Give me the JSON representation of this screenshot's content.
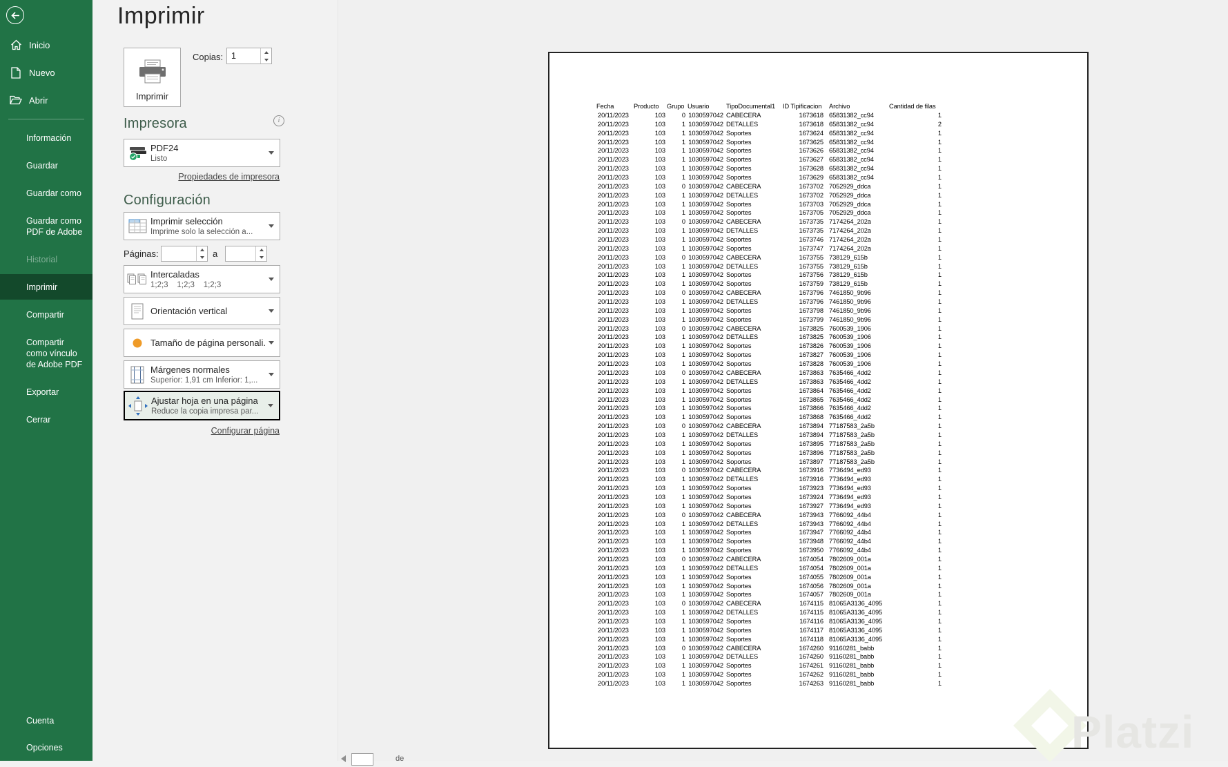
{
  "sidebar": {
    "top_items": [
      {
        "label": "Inicio",
        "icon": "home-icon"
      },
      {
        "label": "Nuevo",
        "icon": "new-doc-icon"
      },
      {
        "label": "Abrir",
        "icon": "open-folder-icon"
      }
    ],
    "menu_items": [
      {
        "label": "Información",
        "state": "normal"
      },
      {
        "label": "Guardar",
        "state": "normal"
      },
      {
        "label": "Guardar como",
        "state": "normal"
      },
      {
        "label": "Guardar como PDF de Adobe",
        "state": "normal"
      },
      {
        "label": "Historial",
        "state": "disabled"
      },
      {
        "label": "Imprimir",
        "state": "selected"
      },
      {
        "label": "Compartir",
        "state": "normal"
      },
      {
        "label": "Compartir como vínculo de Adobe PDF",
        "state": "normal"
      },
      {
        "label": "Exportar",
        "state": "normal"
      },
      {
        "label": "Cerrar",
        "state": "normal"
      }
    ],
    "bottom_items": [
      {
        "label": "Cuenta"
      },
      {
        "label": "Opciones"
      }
    ]
  },
  "page": {
    "title": "Imprimir"
  },
  "print": {
    "button_label": "Imprimir",
    "copies_label": "Copias:",
    "copies_value": "1"
  },
  "printer": {
    "heading": "Impresora",
    "name": "PDF24",
    "status": "Listo",
    "properties_link": "Propiedades de impresora"
  },
  "settings": {
    "heading": "Configuración",
    "print_what": {
      "title": "Imprimir selección",
      "subtitle": "Imprime solo la selección a..."
    },
    "pages": {
      "label": "Páginas:",
      "from_value": "",
      "to_label": "a",
      "to_value": ""
    },
    "collation": {
      "title": "Intercaladas",
      "subtitle": "1;2;3    1;2;3    1;2;3"
    },
    "orientation": {
      "title": "Orientación vertical"
    },
    "paper_size": {
      "title": "Tamaño de página personali..."
    },
    "margins": {
      "title": "Márgenes normales",
      "subtitle": "Superior: 1,91 cm Inferior: 1,..."
    },
    "scaling": {
      "title": "Ajustar hoja en una página",
      "subtitle": "Reduce la copia impresa par..."
    },
    "page_setup_link": "Configurar página"
  },
  "preview": {
    "nav": {
      "separator": "de"
    },
    "table": {
      "headers": [
        "Fecha",
        "Producto",
        "Grupo",
        "Usuario",
        "TipoDocumental1",
        "ID Tipificacion",
        "Archivo",
        "Cantidad de filas"
      ],
      "rows": [
        [
          "20/11/2023",
          "103",
          "0",
          "1030597042",
          "CABECERA",
          "1673618",
          "65831382_cc94",
          "1"
        ],
        [
          "20/11/2023",
          "103",
          "1",
          "1030597042",
          "DETALLES",
          "1673618",
          "65831382_cc94",
          "2"
        ],
        [
          "20/11/2023",
          "103",
          "1",
          "1030597042",
          "Soportes",
          "1673624",
          "65831382_cc94",
          "1"
        ],
        [
          "20/11/2023",
          "103",
          "1",
          "1030597042",
          "Soportes",
          "1673625",
          "65831382_cc94",
          "1"
        ],
        [
          "20/11/2023",
          "103",
          "1",
          "1030597042",
          "Soportes",
          "1673626",
          "65831382_cc94",
          "1"
        ],
        [
          "20/11/2023",
          "103",
          "1",
          "1030597042",
          "Soportes",
          "1673627",
          "65831382_cc94",
          "1"
        ],
        [
          "20/11/2023",
          "103",
          "1",
          "1030597042",
          "Soportes",
          "1673628",
          "65831382_cc94",
          "1"
        ],
        [
          "20/11/2023",
          "103",
          "1",
          "1030597042",
          "Soportes",
          "1673629",
          "65831382_cc94",
          "1"
        ],
        [
          "20/11/2023",
          "103",
          "0",
          "1030597042",
          "CABECERA",
          "1673702",
          "7052929_ddca",
          "1"
        ],
        [
          "20/11/2023",
          "103",
          "1",
          "1030597042",
          "DETALLES",
          "1673702",
          "7052929_ddca",
          "1"
        ],
        [
          "20/11/2023",
          "103",
          "1",
          "1030597042",
          "Soportes",
          "1673703",
          "7052929_ddca",
          "1"
        ],
        [
          "20/11/2023",
          "103",
          "1",
          "1030597042",
          "Soportes",
          "1673705",
          "7052929_ddca",
          "1"
        ],
        [
          "20/11/2023",
          "103",
          "0",
          "1030597042",
          "CABECERA",
          "1673735",
          "7174264_202a",
          "1"
        ],
        [
          "20/11/2023",
          "103",
          "1",
          "1030597042",
          "DETALLES",
          "1673735",
          "7174264_202a",
          "1"
        ],
        [
          "20/11/2023",
          "103",
          "1",
          "1030597042",
          "Soportes",
          "1673746",
          "7174264_202a",
          "1"
        ],
        [
          "20/11/2023",
          "103",
          "1",
          "1030597042",
          "Soportes",
          "1673747",
          "7174264_202a",
          "1"
        ],
        [
          "20/11/2023",
          "103",
          "0",
          "1030597042",
          "CABECERA",
          "1673755",
          "738129_615b",
          "1"
        ],
        [
          "20/11/2023",
          "103",
          "1",
          "1030597042",
          "DETALLES",
          "1673755",
          "738129_615b",
          "1"
        ],
        [
          "20/11/2023",
          "103",
          "1",
          "1030597042",
          "Soportes",
          "1673756",
          "738129_615b",
          "1"
        ],
        [
          "20/11/2023",
          "103",
          "1",
          "1030597042",
          "Soportes",
          "1673759",
          "738129_615b",
          "1"
        ],
        [
          "20/11/2023",
          "103",
          "0",
          "1030597042",
          "CABECERA",
          "1673796",
          "7461850_9b96",
          "1"
        ],
        [
          "20/11/2023",
          "103",
          "1",
          "1030597042",
          "DETALLES",
          "1673796",
          "7461850_9b96",
          "1"
        ],
        [
          "20/11/2023",
          "103",
          "1",
          "1030597042",
          "Soportes",
          "1673798",
          "7461850_9b96",
          "1"
        ],
        [
          "20/11/2023",
          "103",
          "1",
          "1030597042",
          "Soportes",
          "1673799",
          "7461850_9b96",
          "1"
        ],
        [
          "20/11/2023",
          "103",
          "0",
          "1030597042",
          "CABECERA",
          "1673825",
          "7600539_1906",
          "1"
        ],
        [
          "20/11/2023",
          "103",
          "1",
          "1030597042",
          "DETALLES",
          "1673825",
          "7600539_1906",
          "1"
        ],
        [
          "20/11/2023",
          "103",
          "1",
          "1030597042",
          "Soportes",
          "1673826",
          "7600539_1906",
          "1"
        ],
        [
          "20/11/2023",
          "103",
          "1",
          "1030597042",
          "Soportes",
          "1673827",
          "7600539_1906",
          "1"
        ],
        [
          "20/11/2023",
          "103",
          "1",
          "1030597042",
          "Soportes",
          "1673828",
          "7600539_1906",
          "1"
        ],
        [
          "20/11/2023",
          "103",
          "0",
          "1030597042",
          "CABECERA",
          "1673863",
          "7635466_4dd2",
          "1"
        ],
        [
          "20/11/2023",
          "103",
          "1",
          "1030597042",
          "DETALLES",
          "1673863",
          "7635466_4dd2",
          "1"
        ],
        [
          "20/11/2023",
          "103",
          "1",
          "1030597042",
          "Soportes",
          "1673864",
          "7635466_4dd2",
          "1"
        ],
        [
          "20/11/2023",
          "103",
          "1",
          "1030597042",
          "Soportes",
          "1673865",
          "7635466_4dd2",
          "1"
        ],
        [
          "20/11/2023",
          "103",
          "1",
          "1030597042",
          "Soportes",
          "1673866",
          "7635466_4dd2",
          "1"
        ],
        [
          "20/11/2023",
          "103",
          "1",
          "1030597042",
          "Soportes",
          "1673868",
          "7635466_4dd2",
          "1"
        ],
        [
          "20/11/2023",
          "103",
          "0",
          "1030597042",
          "CABECERA",
          "1673894",
          "77187583_2a5b",
          "1"
        ],
        [
          "20/11/2023",
          "103",
          "1",
          "1030597042",
          "DETALLES",
          "1673894",
          "77187583_2a5b",
          "1"
        ],
        [
          "20/11/2023",
          "103",
          "1",
          "1030597042",
          "Soportes",
          "1673895",
          "77187583_2a5b",
          "1"
        ],
        [
          "20/11/2023",
          "103",
          "1",
          "1030597042",
          "Soportes",
          "1673896",
          "77187583_2a5b",
          "1"
        ],
        [
          "20/11/2023",
          "103",
          "1",
          "1030597042",
          "Soportes",
          "1673897",
          "77187583_2a5b",
          "1"
        ],
        [
          "20/11/2023",
          "103",
          "0",
          "1030597042",
          "CABECERA",
          "1673916",
          "7736494_ed93",
          "1"
        ],
        [
          "20/11/2023",
          "103",
          "1",
          "1030597042",
          "DETALLES",
          "1673916",
          "7736494_ed93",
          "1"
        ],
        [
          "20/11/2023",
          "103",
          "1",
          "1030597042",
          "Soportes",
          "1673923",
          "7736494_ed93",
          "1"
        ],
        [
          "20/11/2023",
          "103",
          "1",
          "1030597042",
          "Soportes",
          "1673924",
          "7736494_ed93",
          "1"
        ],
        [
          "20/11/2023",
          "103",
          "1",
          "1030597042",
          "Soportes",
          "1673927",
          "7736494_ed93",
          "1"
        ],
        [
          "20/11/2023",
          "103",
          "0",
          "1030597042",
          "CABECERA",
          "1673943",
          "7766092_44b4",
          "1"
        ],
        [
          "20/11/2023",
          "103",
          "1",
          "1030597042",
          "DETALLES",
          "1673943",
          "7766092_44b4",
          "1"
        ],
        [
          "20/11/2023",
          "103",
          "1",
          "1030597042",
          "Soportes",
          "1673947",
          "7766092_44b4",
          "1"
        ],
        [
          "20/11/2023",
          "103",
          "1",
          "1030597042",
          "Soportes",
          "1673948",
          "7766092_44b4",
          "1"
        ],
        [
          "20/11/2023",
          "103",
          "1",
          "1030597042",
          "Soportes",
          "1673950",
          "7766092_44b4",
          "1"
        ],
        [
          "20/11/2023",
          "103",
          "0",
          "1030597042",
          "CABECERA",
          "1674054",
          "7802609_001a",
          "1"
        ],
        [
          "20/11/2023",
          "103",
          "1",
          "1030597042",
          "DETALLES",
          "1674054",
          "7802609_001a",
          "1"
        ],
        [
          "20/11/2023",
          "103",
          "1",
          "1030597042",
          "Soportes",
          "1674055",
          "7802609_001a",
          "1"
        ],
        [
          "20/11/2023",
          "103",
          "1",
          "1030597042",
          "Soportes",
          "1674056",
          "7802609_001a",
          "1"
        ],
        [
          "20/11/2023",
          "103",
          "1",
          "1030597042",
          "Soportes",
          "1674057",
          "7802609_001a",
          "1"
        ],
        [
          "20/11/2023",
          "103",
          "0",
          "1030597042",
          "CABECERA",
          "1674115",
          "81065A3136_4095",
          "1"
        ],
        [
          "20/11/2023",
          "103",
          "1",
          "1030597042",
          "DETALLES",
          "1674115",
          "81065A3136_4095",
          "1"
        ],
        [
          "20/11/2023",
          "103",
          "1",
          "1030597042",
          "Soportes",
          "1674116",
          "81065A3136_4095",
          "1"
        ],
        [
          "20/11/2023",
          "103",
          "1",
          "1030597042",
          "Soportes",
          "1674117",
          "81065A3136_4095",
          "1"
        ],
        [
          "20/11/2023",
          "103",
          "1",
          "1030597042",
          "Soportes",
          "1674118",
          "81065A3136_4095",
          "1"
        ],
        [
          "20/11/2023",
          "103",
          "0",
          "1030597042",
          "CABECERA",
          "1674260",
          "91160281_babb",
          "1"
        ],
        [
          "20/11/2023",
          "103",
          "1",
          "1030597042",
          "DETALLES",
          "1674260",
          "91160281_babb",
          "1"
        ],
        [
          "20/11/2023",
          "103",
          "1",
          "1030597042",
          "Soportes",
          "1674261",
          "91160281_babb",
          "1"
        ],
        [
          "20/11/2023",
          "103",
          "1",
          "1030597042",
          "Soportes",
          "1674262",
          "91160281_babb",
          "1"
        ],
        [
          "20/11/2023",
          "103",
          "1",
          "1030597042",
          "Soportes",
          "1674263",
          "91160281_babb",
          "1"
        ]
      ]
    }
  },
  "watermark": {
    "brand": "Platzi"
  },
  "colors": {
    "sidebar_green": "#217346",
    "sidebar_selected": "#13492b",
    "heading_green": "#3d5c4a",
    "highlight_border": "#000000",
    "status_ok_green": "#21a366",
    "custom_size_orange": "#ef9b28"
  }
}
